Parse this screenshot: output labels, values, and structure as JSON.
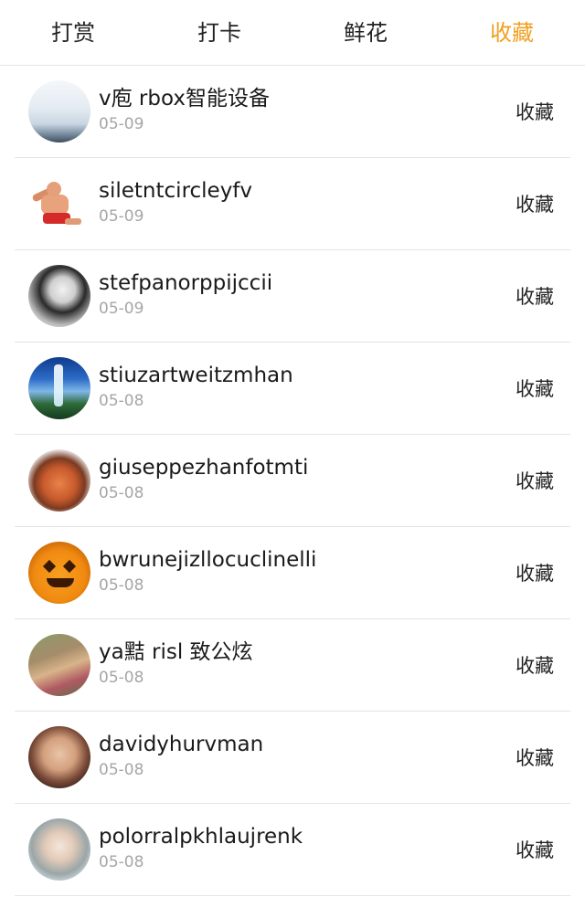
{
  "tabs": [
    {
      "label": "打赏",
      "active": false
    },
    {
      "label": "打卡",
      "active": false
    },
    {
      "label": "鲜花",
      "active": false
    },
    {
      "label": "收藏",
      "active": true
    }
  ],
  "colors": {
    "accent": "#f0a020",
    "text": "#222222",
    "date": "#a6a6a6",
    "divider": "#e4e4e4"
  },
  "rows": [
    {
      "name": "v庖 rbox智能设备",
      "date": "05-09",
      "action": "收藏"
    },
    {
      "name": "siletntcircleyfv",
      "date": "05-09",
      "action": "收藏"
    },
    {
      "name": "stefpanorppijccii",
      "date": "05-09",
      "action": "收藏"
    },
    {
      "name": "stiuzartweitzmhan",
      "date": "05-08",
      "action": "收藏"
    },
    {
      "name": "giuseppezhanfotmti",
      "date": "05-08",
      "action": "收藏"
    },
    {
      "name": "bwrunejizllocuclinelli",
      "date": "05-08",
      "action": "收藏"
    },
    {
      "name": "ya黠 risl 致公炫",
      "date": "05-08",
      "action": "收藏"
    },
    {
      "name": "davidyhurvman",
      "date": "05-08",
      "action": "收藏"
    },
    {
      "name": "polorralpkhlaujrenk",
      "date": "05-08",
      "action": "收藏"
    }
  ]
}
